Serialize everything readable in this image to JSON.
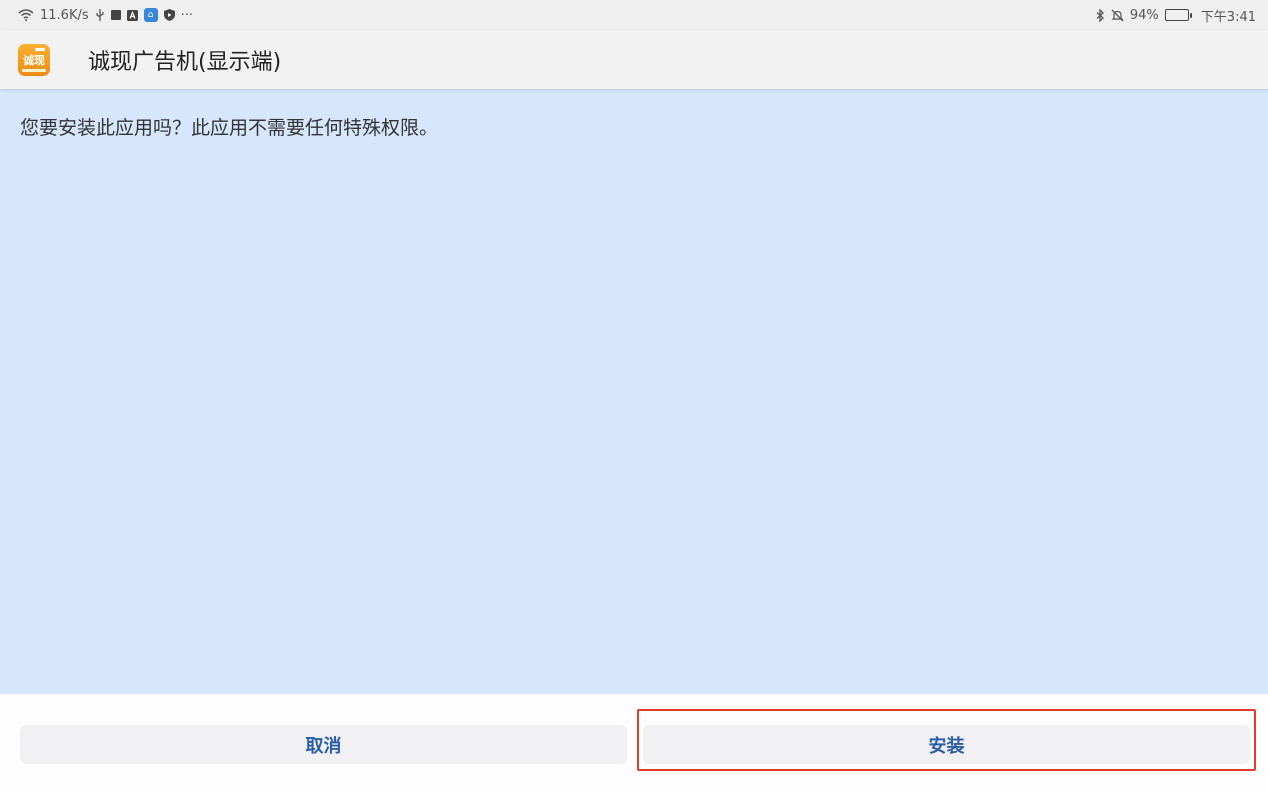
{
  "status_bar": {
    "network_speed": "11.6K/s",
    "battery_percent": "94%",
    "battery_level": 0.94,
    "time": "下午3:41",
    "more_glyph": "···"
  },
  "app": {
    "title": "诚现广告机(显示端)",
    "icon_text": "诚现"
  },
  "content": {
    "message": "您要安装此应用吗？此应用不需要任何特殊权限。"
  },
  "buttons": {
    "cancel": "取消",
    "install": "安装"
  },
  "colors": {
    "content_bg": "#d6e6fc",
    "button_text": "#2a5ea8",
    "highlight": "#e23b2e"
  }
}
